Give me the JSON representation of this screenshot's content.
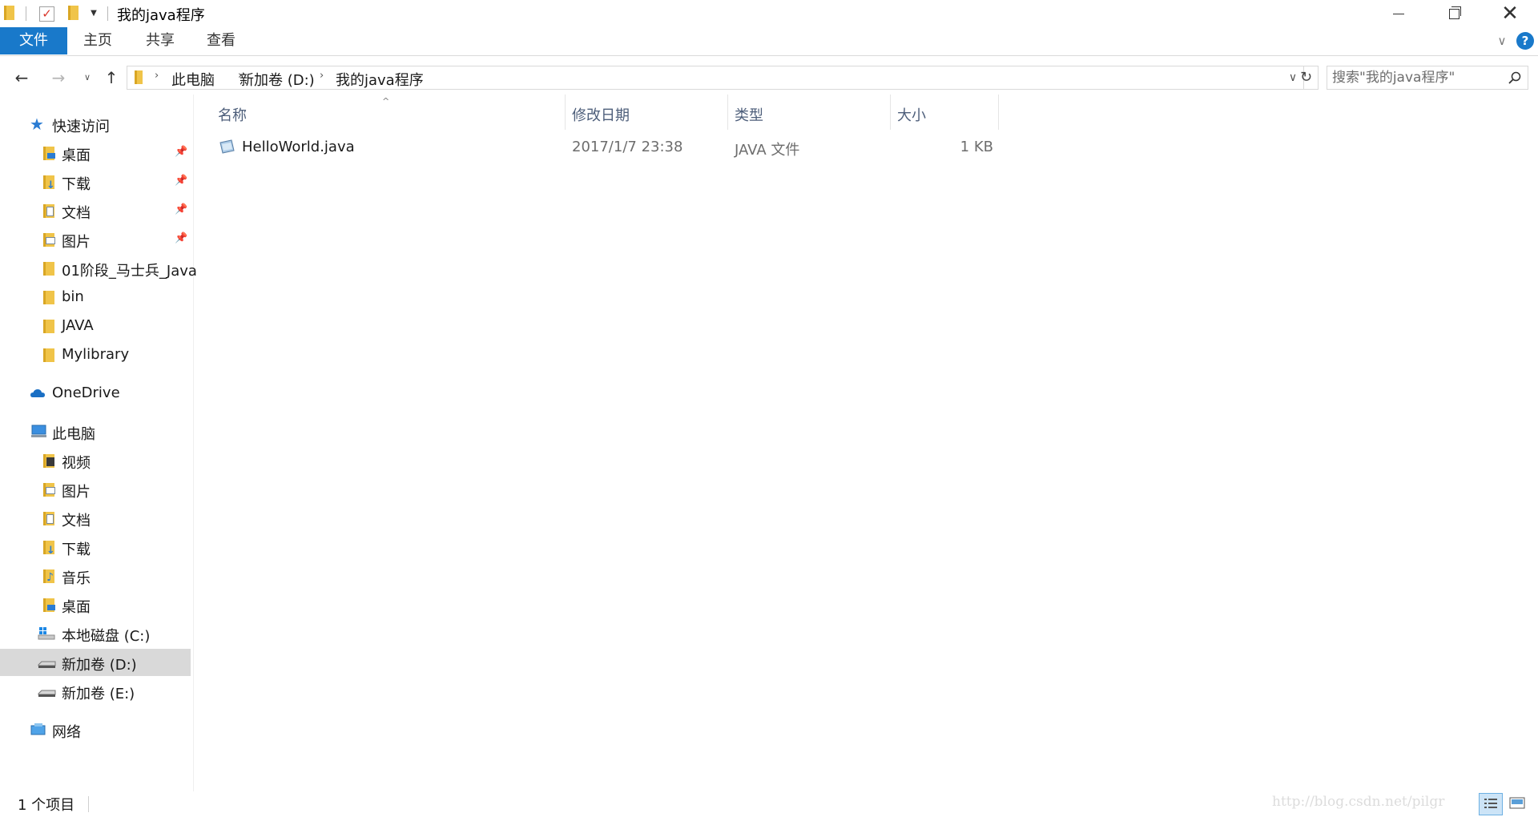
{
  "window": {
    "title": "我的java程序",
    "minimize_icon": "minimize-icon",
    "restore_icon": "restore-icon",
    "close_icon": "close-icon",
    "close_glyph": "✕"
  },
  "ribbon": {
    "tabs": [
      {
        "label": "文件",
        "active": true
      },
      {
        "label": "主页"
      },
      {
        "label": "共享"
      },
      {
        "label": "查看"
      }
    ],
    "expand_glyph": "∨",
    "help_glyph": "?",
    "accent_color": "#1979ca"
  },
  "address": {
    "back_glyph": "←",
    "forward_glyph": "→",
    "recent_glyph": "∨",
    "up_glyph": "↑",
    "breadcrumbs": [
      "此电脑",
      "新加卷 (D:)",
      "我的java程序"
    ],
    "separator": "›",
    "dropdown_glyph": "∨",
    "refresh_glyph": "↻"
  },
  "search": {
    "placeholder": "搜索\"我的java程序\""
  },
  "navigation": {
    "quick_access": "快速访问",
    "quick_items": [
      "桌面",
      "下载",
      "文档",
      "图片",
      "01阶段_马士兵_Java",
      "bin",
      "JAVA",
      "Mylibrary"
    ],
    "onedrive": "OneDrive",
    "this_pc": "此电脑",
    "pc_items": [
      "视频",
      "图片",
      "文档",
      "下载",
      "音乐",
      "桌面",
      "本地磁盘 (C:)",
      "新加卷 (D:)",
      "新加卷 (E:)"
    ],
    "network": "网络",
    "pin_glyph": "📌",
    "selected_item": "新加卷 (D:)"
  },
  "columns": {
    "name": "名称",
    "modified": "修改日期",
    "type": "类型",
    "size": "大小",
    "sort_glyph": "^"
  },
  "files": [
    {
      "name": "HelloWorld.java",
      "modified": "2017/1/7 23:38",
      "type": "JAVA 文件",
      "size": "1 KB"
    }
  ],
  "status": {
    "item_count": "1 个项目",
    "watermark": "http://blog.csdn.net/pilgr"
  }
}
